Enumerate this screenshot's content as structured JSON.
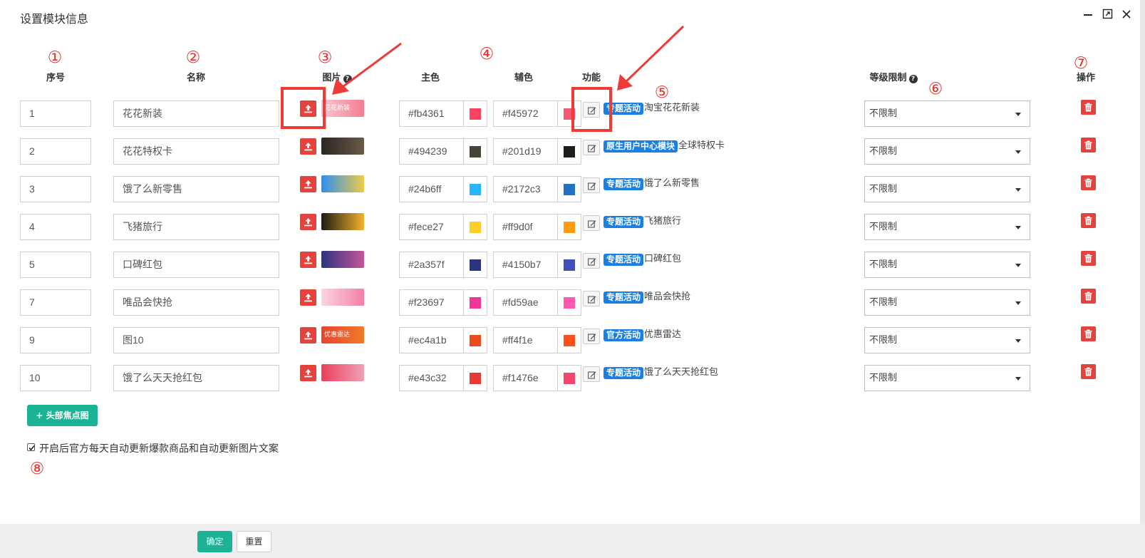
{
  "dialog": {
    "title": "设置模块信息",
    "icons": [
      "minimize-icon",
      "maximize-icon",
      "close-icon"
    ]
  },
  "markers": [
    "①",
    "②",
    "③",
    "④",
    "⑤",
    "⑥",
    "⑦",
    "⑧"
  ],
  "columns": {
    "seq": "序号",
    "name": "名称",
    "image": "图片",
    "primary": "主色",
    "secondary": "辅色",
    "function": "功能",
    "level": "等级限制",
    "action": "操作"
  },
  "rows": [
    {
      "seq": "1",
      "name": "花花新装",
      "thumb_text": "花花新装",
      "thumb_colors": [
        "#f9c7d1",
        "#f27d92"
      ],
      "primary": "#fb4361",
      "primary_color": "#fb4361",
      "secondary": "#f45972",
      "secondary_color": "#f45972",
      "tag": "专题活动",
      "func": "淘宝花花新装",
      "level": "不限制"
    },
    {
      "seq": "2",
      "name": "花花特权卡",
      "thumb_text": "",
      "thumb_colors": [
        "#2b2622",
        "#6a5a48"
      ],
      "primary": "#494239",
      "primary_color": "#494239",
      "secondary": "#201d19",
      "secondary_color": "#201d19",
      "tag": "原生用户中心模块",
      "func": "全球特权卡",
      "level": "不限制"
    },
    {
      "seq": "3",
      "name": "饿了么新零售",
      "thumb_text": "",
      "thumb_colors": [
        "#2d8ff0",
        "#f0c94a"
      ],
      "primary": "#24b6ff",
      "primary_color": "#24b6ff",
      "secondary": "#2172c3",
      "secondary_color": "#2172c3",
      "tag": "专题活动",
      "func": "饿了么新零售",
      "level": "不限制"
    },
    {
      "seq": "4",
      "name": "飞猪旅行",
      "thumb_text": "",
      "thumb_colors": [
        "#1e1a16",
        "#f2b42a"
      ],
      "primary": "#fece27",
      "primary_color": "#fece27",
      "secondary": "#ff9d0f",
      "secondary_color": "#ff9d0f",
      "tag": "专题活动",
      "func": "飞猪旅行",
      "level": "不限制"
    },
    {
      "seq": "5",
      "name": "口碑红包",
      "thumb_text": "",
      "thumb_colors": [
        "#2a357f",
        "#c8549a"
      ],
      "primary": "#2a357f",
      "primary_color": "#2a357f",
      "secondary": "#4150b7",
      "secondary_color": "#4150b7",
      "tag": "专题活动",
      "func": "口碑红包",
      "level": "不限制"
    },
    {
      "seq": "7",
      "name": "唯品会快抢",
      "thumb_text": "",
      "thumb_colors": [
        "#fbd4e2",
        "#f57fa8"
      ],
      "primary": "#f23697",
      "primary_color": "#f23697",
      "secondary": "#fd59ae",
      "secondary_color": "#fd59ae",
      "tag": "专题活动",
      "func": "唯品会快抢",
      "level": "不限制"
    },
    {
      "seq": "9",
      "name": "图10",
      "thumb_text": "优惠雷达",
      "thumb_colors": [
        "#e8442a",
        "#f07b2a"
      ],
      "primary": "#ec4a1b",
      "primary_color": "#ec4a1b",
      "secondary": "#ff4f1e",
      "secondary_color": "#ff4f1e",
      "tag": "官方活动",
      "func": "优惠雷达",
      "level": "不限制"
    },
    {
      "seq": "10",
      "name": "饿了么天天抢红包",
      "thumb_text": "",
      "thumb_colors": [
        "#e8405a",
        "#f0a0b8"
      ],
      "primary": "#e43c32",
      "primary_color": "#e43c32",
      "secondary": "#f1476e",
      "secondary_color": "#f1476e",
      "tag": "专题活动",
      "func": "饿了么天天抢红包",
      "level": "不限制"
    }
  ],
  "add_button": "+ 头部焦点图",
  "checkbox": {
    "checked": true,
    "label": "开启后官方每天自动更新爆款商品和自动更新图片文案"
  },
  "footer": {
    "ok": "确定",
    "reset": "重置"
  },
  "colors": {
    "accent_green": "#1cb394",
    "danger_red": "#e5423d",
    "tag_blue": "#1a7fe0",
    "annotation_red": "#ef3b35"
  }
}
